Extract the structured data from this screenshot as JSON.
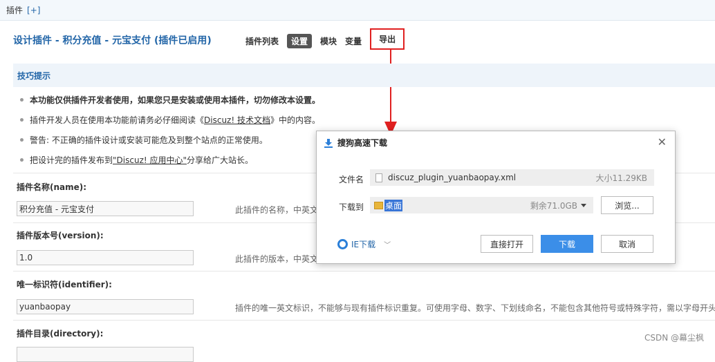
{
  "topbar": {
    "label": "插件",
    "plus": "[+]"
  },
  "page_title": "设计插件 - 积分充值 - 元宝支付 (插件已启用)",
  "nav": [
    {
      "label": "插件列表"
    },
    {
      "label": "设置"
    },
    {
      "label": "模块"
    },
    {
      "label": "变量"
    },
    {
      "label": "导出"
    }
  ],
  "tips": {
    "heading": "技巧提示",
    "items": [
      {
        "text": "本功能仅供插件开发者使用，如果您只是安装或使用本插件，切勿修改本设置。"
      },
      {
        "pre": "插件开发人员在使用本功能前请务必仔细阅读《 ",
        "link": "Discuz! 技术文档",
        "post": " 》中的内容。"
      },
      {
        "text": "警告: 不正确的插件设计或安装可能危及到整个站点的正常使用。"
      },
      {
        "pre": "把设计完的插件发布到 ",
        "link": "\"Discuz! 应用中心\"",
        "post": " 分享给广大站长。"
      }
    ]
  },
  "fields": [
    {
      "label": "插件名称(name):",
      "value": "积分充值 - 元宝支付",
      "desc": "此插件的名称，中英文"
    },
    {
      "label": "插件版本号(version):",
      "value": "1.0",
      "desc": "此插件的版本，中英文"
    },
    {
      "label": "唯一标识符(identifier):",
      "value": "yuanbaopay",
      "desc": "插件的唯一英文标识，不能够与现有插件标识重复。可使用字母、数字、下划线命名，不能包含其他符号或特殊字符，需以字母开头"
    },
    {
      "label": "插件目录(directory):"
    }
  ],
  "dialog": {
    "title": "搜狗高速下载",
    "filename_label": "文件名",
    "filename": "discuz_plugin_yuanbaopay.xml",
    "size": "大小11.29KB",
    "dir_label": "下载到",
    "dir": "桌面",
    "free": "剩余71.0GB",
    "browse": "浏览...",
    "ie_download": "IE下载",
    "open_direct": "直接打开",
    "download": "下载",
    "cancel": "取消"
  },
  "watermark": "CSDN @幕尘枫"
}
